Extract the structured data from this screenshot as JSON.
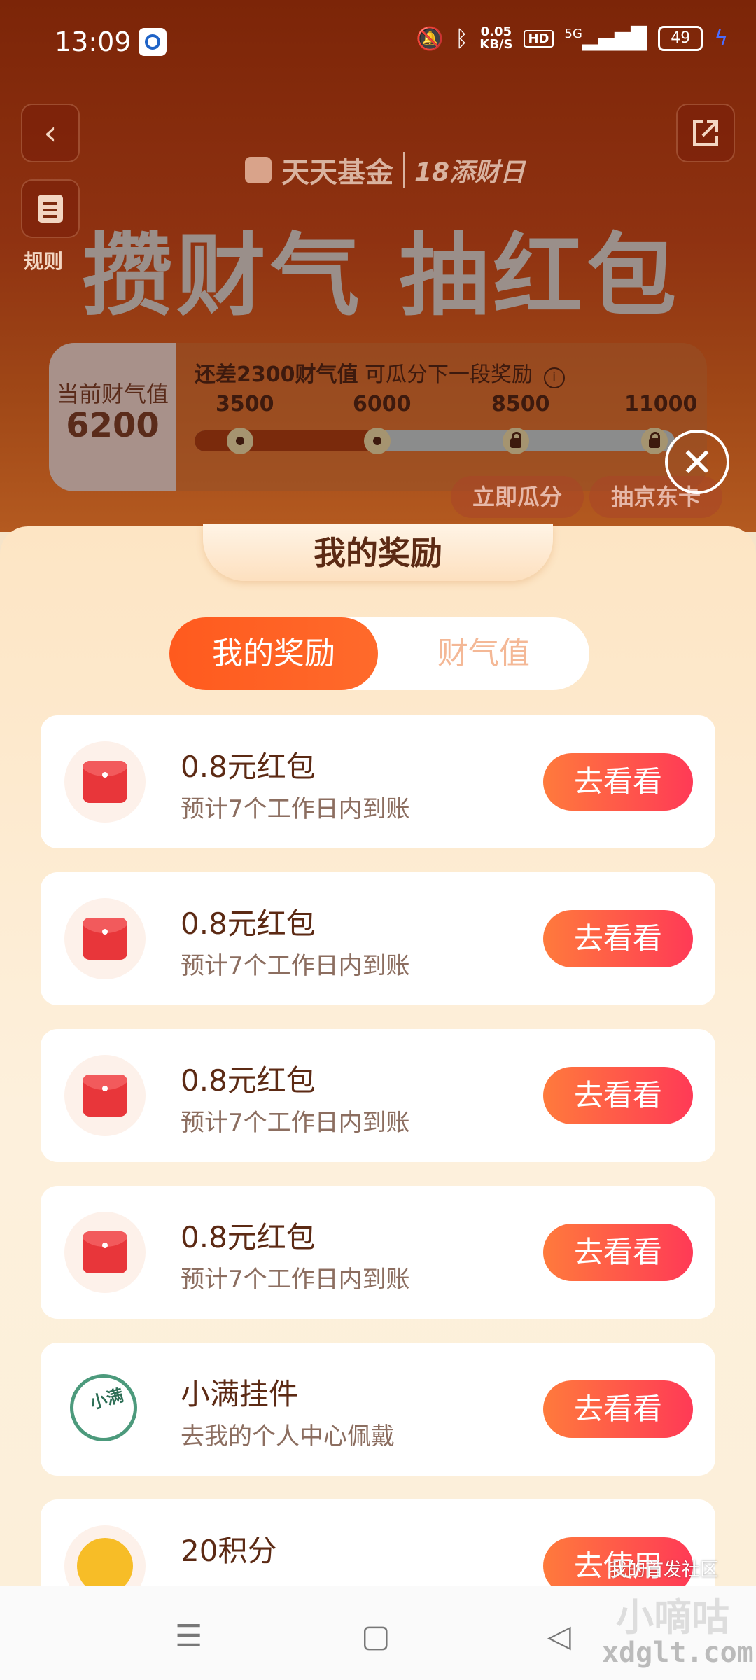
{
  "status_bar": {
    "time": "13:09",
    "net_speed": "0.05",
    "net_unit": "KB/S",
    "hd": "HD",
    "signal": "5G",
    "battery": "49",
    "icons": [
      "mute-bell-icon",
      "bluetooth-icon",
      "signal-icon",
      "battery-icon",
      "charging-icon"
    ]
  },
  "header": {
    "brand": "天天基金",
    "brand_sub": "18添财日",
    "headline": "攒财气 抽红包",
    "rules_label": "规则"
  },
  "progress": {
    "current_label": "当前财气值",
    "current_value": "6200",
    "hint_bold": "还差2300财气值",
    "hint_rest": "可瓜分下一段奖励",
    "milestones": [
      "3500",
      "6000",
      "8500",
      "11000"
    ],
    "progress_fraction": 0.38,
    "action_claim": "立即瓜分",
    "action_draw": "抽京东卡"
  },
  "sheet": {
    "title": "我的奖励",
    "tabs": [
      "我的奖励",
      "财气值"
    ],
    "active_tab": 0
  },
  "rewards": [
    {
      "title": "0.8元红包",
      "desc": "预计7个工作日内到账",
      "button": "去看看",
      "icon": "red-packet-icon"
    },
    {
      "title": "0.8元红包",
      "desc": "预计7个工作日内到账",
      "button": "去看看",
      "icon": "red-packet-icon"
    },
    {
      "title": "0.8元红包",
      "desc": "预计7个工作日内到账",
      "button": "去看看",
      "icon": "red-packet-icon"
    },
    {
      "title": "0.8元红包",
      "desc": "预计7个工作日内到账",
      "button": "去看看",
      "icon": "red-packet-icon"
    },
    {
      "title": "小满挂件",
      "desc": "去我的个人中心佩戴",
      "button": "去看看",
      "icon": "pendant-badge-icon",
      "badge_text": "小满"
    },
    {
      "title": "20积分",
      "desc": "",
      "button": "去使用",
      "icon": "points-coin-icon"
    }
  ],
  "watermark": {
    "small": "我的首发社区",
    "big": "小嘀咕",
    "url": "xdglt.com"
  },
  "colors": {
    "accent": "#ff5a1e",
    "button_gradient_start": "#ff7a3c",
    "button_gradient_end": "#ff3a56",
    "sheet_bg": "#fde5c4"
  }
}
